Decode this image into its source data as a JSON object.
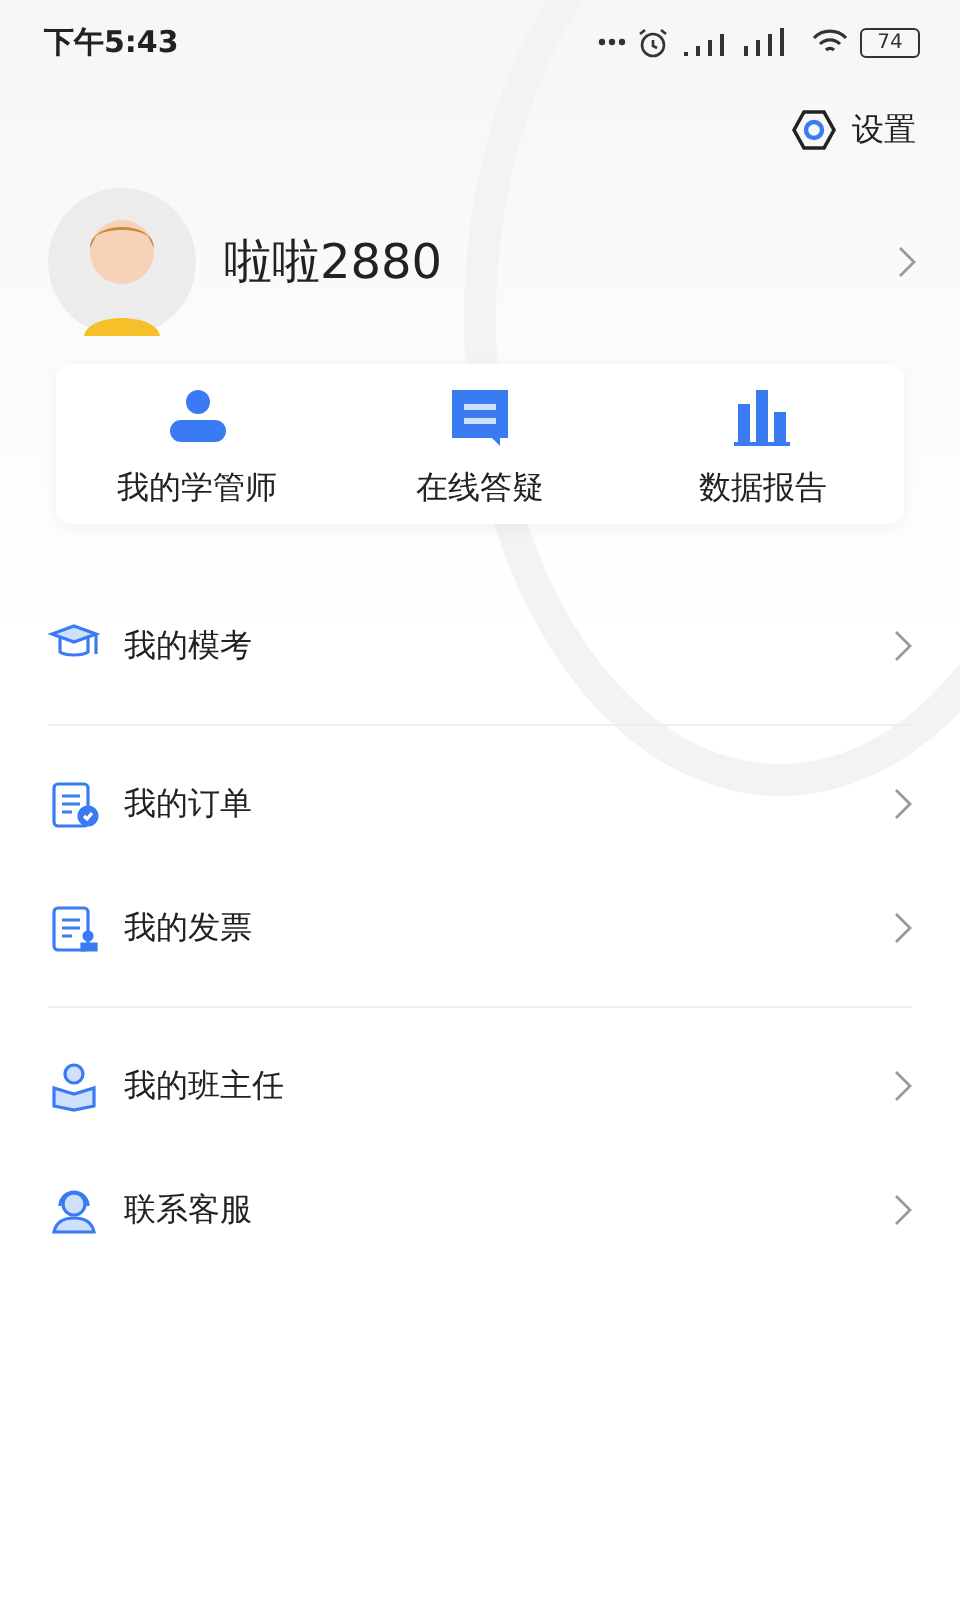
{
  "status_bar": {
    "time": "下午5:43",
    "battery": "74"
  },
  "settings": {
    "label": "设置"
  },
  "profile": {
    "name": "啦啦2880"
  },
  "quick_actions": [
    {
      "kind": "person",
      "label": "我的学管师"
    },
    {
      "kind": "chat",
      "label": "在线答疑"
    },
    {
      "kind": "chart",
      "label": "数据报告"
    }
  ],
  "menu_groups": [
    [
      {
        "kind": "cap",
        "label": "我的模考"
      }
    ],
    [
      {
        "kind": "order",
        "label": "我的订单"
      },
      {
        "kind": "invoice",
        "label": "我的发票"
      }
    ],
    [
      {
        "kind": "teacher",
        "label": "我的班主任"
      },
      {
        "kind": "service",
        "label": "联系客服"
      }
    ]
  ]
}
